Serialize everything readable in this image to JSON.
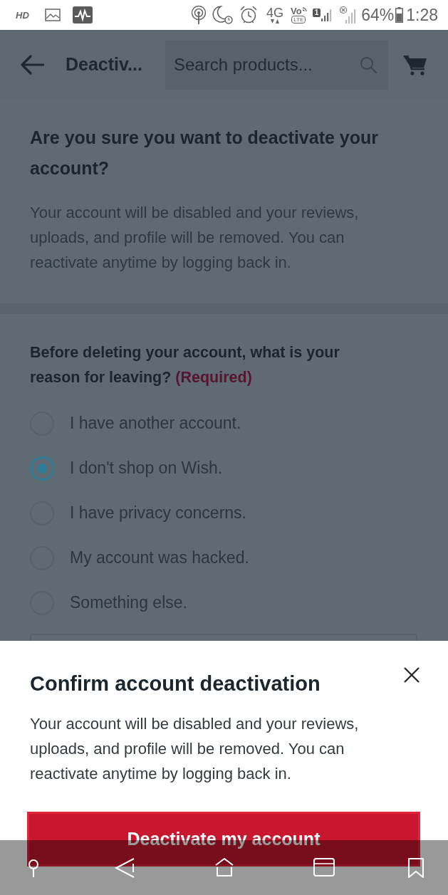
{
  "status_bar": {
    "quality_label": "HD",
    "network_type": "4G",
    "volte_label": "Vo",
    "lte_label": "LTE",
    "sim_badge": "1",
    "battery_percent": "64%",
    "time": "1:28"
  },
  "header": {
    "title": "Deactiv...",
    "search": {
      "placeholder": "Search products..."
    }
  },
  "intro": {
    "heading": "Are you sure you want to deactivate your account?",
    "body": "Your account will be disabled and your reviews, uploads, and profile will be removed. You can reactivate anytime by logging back in."
  },
  "reason": {
    "question": "Before deleting your account, what is your reason for leaving?",
    "required_label": "(Required)",
    "options": [
      {
        "label": "I have another account.",
        "selected": false
      },
      {
        "label": "I don't shop on Wish.",
        "selected": true
      },
      {
        "label": "I have privacy concerns.",
        "selected": false
      },
      {
        "label": "My account was hacked.",
        "selected": false
      },
      {
        "label": "Something else.",
        "selected": false
      }
    ]
  },
  "dialog": {
    "title": "Confirm account deactivation",
    "body": "Your account will be disabled and your reviews, uploads, and profile will be removed. You can reactivate anytime by logging back in.",
    "confirm_button": "Deactivate my account"
  }
}
